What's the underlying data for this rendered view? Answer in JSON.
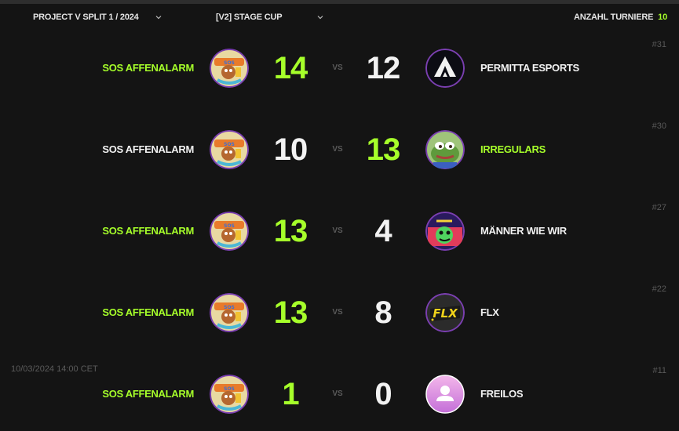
{
  "filters": {
    "season": "PROJECT V SPLIT 1 / 2024",
    "cup": "[V2] STAGE CUP"
  },
  "tournaments": {
    "label": "ANZAHL TURNIERE",
    "count": "10"
  },
  "vs_label": "VS",
  "matches": [
    {
      "id": "#31",
      "date": "",
      "left_team": "SOS AFFENALARM",
      "left_score": "14",
      "right_score": "12",
      "right_team": "PERMITTA ESPORTS",
      "winner": "left",
      "left_logo": "monkey-logo-icon",
      "right_logo": "triangle-logo-icon"
    },
    {
      "id": "#30",
      "date": "",
      "left_team": "SOS AFFENALARM",
      "left_score": "10",
      "right_score": "13",
      "right_team": "IRREGULARS",
      "winner": "right",
      "left_logo": "monkey-logo-icon",
      "right_logo": "frog-logo-icon"
    },
    {
      "id": "#27",
      "date": "",
      "left_team": "SOS AFFENALARM",
      "left_score": "13",
      "right_score": "4",
      "right_team": "MÄNNER WIE WIR",
      "winner": "left",
      "left_logo": "monkey-logo-icon",
      "right_logo": "cartoon-logo-icon"
    },
    {
      "id": "#22",
      "date": "",
      "left_team": "SOS AFFENALARM",
      "left_score": "13",
      "right_score": "8",
      "right_team": "FLX",
      "winner": "left",
      "left_logo": "monkey-logo-icon",
      "right_logo": "flx-logo-icon"
    },
    {
      "id": "#11",
      "date": "10/03/2024 14:00 CET",
      "left_team": "SOS AFFENALARM",
      "left_score": "1",
      "right_score": "0",
      "right_team": "FREILOS",
      "winner": "left",
      "left_logo": "monkey-logo-icon",
      "right_logo": "default-avatar-icon"
    }
  ],
  "colors": {
    "background": "#141414",
    "accent": "#a6ff2a",
    "muted": "#5a5a5a"
  }
}
